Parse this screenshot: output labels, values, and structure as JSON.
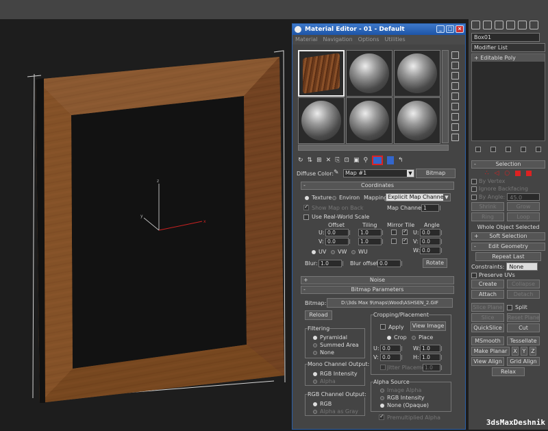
{
  "watermark": "3dsMaxDeshnik",
  "material_editor": {
    "title": "Material Editor - 01 - Default",
    "menu": [
      "Material",
      "Navigation",
      "Options",
      "Utilities"
    ],
    "diffuse_label": "Diffuse Color:",
    "map_name": "Map #1",
    "map_type": "Bitmap",
    "coordinates": {
      "header": "Coordinates",
      "texture": "Texture",
      "environ": "Environ",
      "mapping_label": "Mapping:",
      "mapping_value": "Explicit Map Channel",
      "show_map_on_back": "Show Map on Back",
      "map_channel_label": "Map Channel:",
      "map_channel_value": "1",
      "real_world": "Use Real-World Scale",
      "offset": "Offset",
      "tiling": "Tiling",
      "mirror_tile": "Mirror Tile",
      "angle": "Angle",
      "u": "U:",
      "v": "V:",
      "w": "W:",
      "u_offset": "0.0",
      "v_offset": "0.0",
      "u_tiling": "1.0",
      "v_tiling": "1.0",
      "u_angle": "0.0",
      "v_angle": "0.0",
      "w_angle": "0.0",
      "uv": "UV",
      "vw": "VW",
      "wu": "WU",
      "blur_label": "Blur:",
      "blur_value": "1.0",
      "blur_offset_label": "Blur offset:",
      "blur_offset_value": "0.0",
      "rotate": "Rotate"
    },
    "noise_header": "Noise",
    "bitmap_params": {
      "header": "Bitmap Parameters",
      "bitmap_label": "Bitmap:",
      "bitmap_path": "D:\\3ds Max 9\\maps\\Wood\\ASHSEN_2.GIF",
      "reload": "Reload",
      "filtering": "Filtering",
      "pyramidal": "Pyramidal",
      "summed_area": "Summed Area",
      "none": "None",
      "mono_channel": "Mono Channel Output:",
      "rgb_intensity": "RGB Intensity",
      "alpha": "Alpha",
      "rgb_channel": "RGB Channel Output:",
      "rgb": "RGB",
      "alpha_gray": "Alpha as Gray",
      "cropping": "Cropping/Placement",
      "apply": "Apply",
      "view_image": "View Image",
      "crop": "Crop",
      "place": "Place",
      "u_label": "U:",
      "v_label": "V:",
      "w_label": "W:",
      "h_label": "H:",
      "u_val": "0.0",
      "v_val": "0.0",
      "w_val": "1.0",
      "h_val": "1.0",
      "jitter": "Jitter Placement:",
      "jitter_val": "1.0",
      "alpha_source": "Alpha Source",
      "image_alpha": "Image Alpha",
      "rgb_int": "RGB Intensity",
      "none_opaque": "None (Opaque)",
      "premultiplied": "Premultiplied Alpha"
    }
  },
  "command_panel": {
    "object_name": "Box01",
    "modifier_list": "Modifier List",
    "stack_item": "Editable Poly",
    "selection": {
      "header": "Selection",
      "by_vertex": "By Vertex",
      "ignore_backfacing": "Ignore Backfacing",
      "by_angle": "By Angle:",
      "angle_value": "45.0",
      "shrink": "Shrink",
      "grow": "Grow",
      "ring": "Ring",
      "loop": "Loop",
      "status": "Whole Object Selected"
    },
    "soft_selection": "Soft Selection",
    "edit_geometry": {
      "header": "Edit Geometry",
      "repeat_last": "Repeat Last",
      "constraints": "Constraints:",
      "constraints_value": "None",
      "preserve_uvs": "Preserve UVs",
      "create": "Create",
      "collapse": "Collapse",
      "attach": "Attach",
      "detach": "Detach",
      "slice_plane": "Slice Plane",
      "split": "Split",
      "slice": "Slice",
      "reset_plane": "Reset Plane",
      "quickslice": "QuickSlice",
      "cut": "Cut",
      "msmooth": "MSmooth",
      "tessellate": "Tessellate",
      "make_planar": "Make Planar",
      "x": "X",
      "y": "Y",
      "z": "Z",
      "view_align": "View Align",
      "grid_align": "Grid Align",
      "relax": "Relax"
    }
  },
  "axis": {
    "x": "x",
    "y": "y",
    "z": "z"
  },
  "colors": {
    "wood": "#7a4a26",
    "title_blue": "#2a62b8",
    "highlight_red": "#d22222"
  }
}
